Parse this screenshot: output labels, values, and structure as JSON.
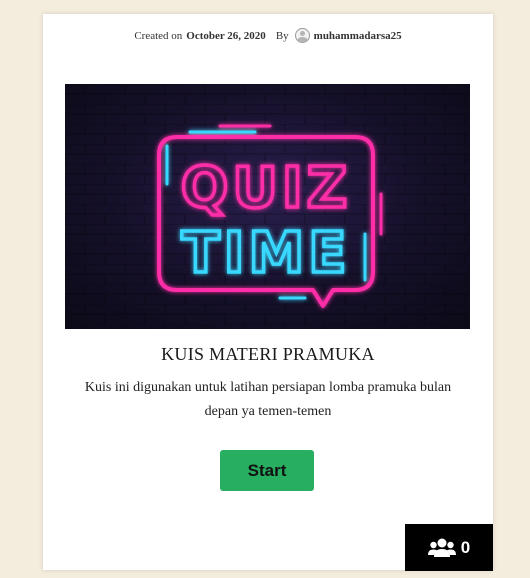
{
  "meta": {
    "created_prefix": "Created on",
    "date": "October 26, 2020",
    "by": "By",
    "author": "muhammadarsa25",
    "avatar_icon": "user-avatar-icon"
  },
  "hero": {
    "image_text_line1": "QUIZ",
    "image_text_line2": "TIME"
  },
  "quiz": {
    "title": "KUIS MATERI PRAMUKA",
    "description": "Kuis ini digunakan untuk latihan persiapan lomba pramuka bulan depan ya temen-temen",
    "start_label": "Start"
  },
  "players": {
    "icon": "users-icon",
    "count": "0"
  },
  "colors": {
    "page_background": "#f4ecdd",
    "start_button": "#27ae60",
    "neon_pink": "#ff2fa8",
    "neon_cyan": "#39d8ff"
  }
}
